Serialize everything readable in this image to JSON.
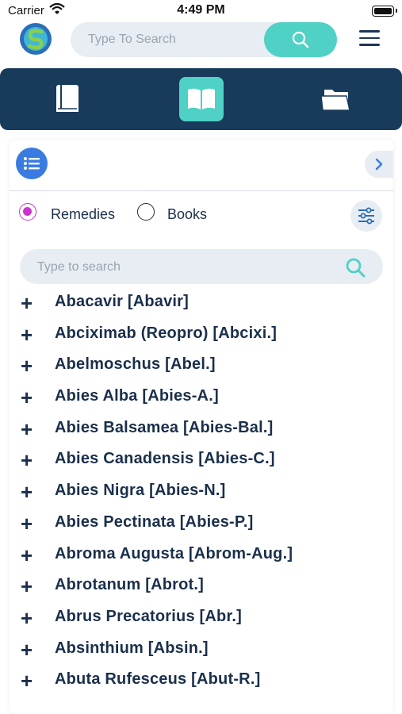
{
  "status": {
    "carrier": "Carrier",
    "time": "4:49 PM"
  },
  "header": {
    "search_placeholder": "Type To Search"
  },
  "tabs": [
    {
      "icon": "book-icon",
      "active": false
    },
    {
      "icon": "open-book-icon",
      "active": true
    },
    {
      "icon": "folder-icon",
      "active": false
    }
  ],
  "filter": {
    "options": [
      {
        "label": "Remedies",
        "selected": true
      },
      {
        "label": "Books",
        "selected": false
      }
    ]
  },
  "list_search": {
    "placeholder": "Type to search"
  },
  "remedies": [
    "Abacavir [Abavir]",
    "Abciximab (Reopro) [Abcixi.]",
    "Abelmoschus [Abel.]",
    "Abies Alba [Abies-A.]",
    "Abies Balsamea [Abies-Bal.]",
    "Abies Canadensis [Abies-C.]",
    "Abies Nigra [Abies-N.]",
    "Abies Pectinata [Abies-P.]",
    "Abroma Augusta [Abrom-Aug.]",
    "Abrotanum [Abrot.]",
    "Abrus Precatorius [Abr.]",
    "Absinthium [Absin.]",
    "Abuta Rufesceus [Abut-R.]"
  ],
  "colors": {
    "accent": "#4fd1c5",
    "navy": "#183a5b",
    "radio": "#cc33cc",
    "list_button": "#3a7be0"
  }
}
